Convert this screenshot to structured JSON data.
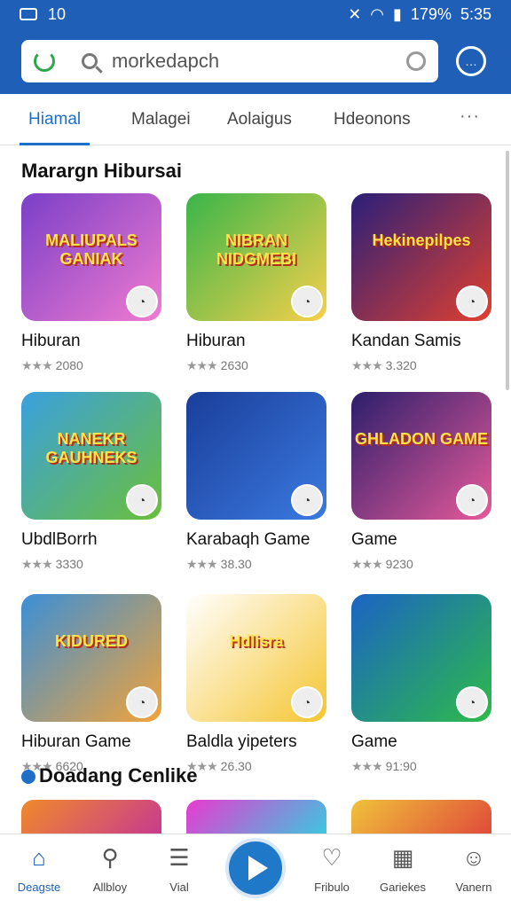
{
  "status": {
    "left_number": "10",
    "right_battery": "179%",
    "time": "5:35"
  },
  "search": {
    "value": "morkedapch"
  },
  "tabs": [
    {
      "label": "Hiamal",
      "active": true
    },
    {
      "label": "Malagei",
      "active": false
    },
    {
      "label": "Aolaigus",
      "active": false
    },
    {
      "label": "Hdeonons",
      "active": false
    }
  ],
  "tab_more": "···",
  "section1": {
    "title": "Marargn Hibursai"
  },
  "section2": {
    "title": "Doadang Cenlike"
  },
  "cards": [
    {
      "name": "Hiburan",
      "stars": "★★★",
      "rating": "2080",
      "art_text": "MALIUPALS GANIAK",
      "colors": [
        "#7a3fc8",
        "#f07bd0"
      ]
    },
    {
      "name": "Hiburan",
      "stars": "★★★",
      "rating": "2630",
      "art_text": "NIBRAN NIDGMEBI",
      "colors": [
        "#39b54a",
        "#f7d04b"
      ]
    },
    {
      "name": "Kandan Samis",
      "stars": "★★★",
      "rating": "3.320",
      "art_text": "Hekinepilpes",
      "colors": [
        "#2a1f7a",
        "#e0402f"
      ]
    },
    {
      "name": "UbdlBorrh",
      "stars": "★★★",
      "rating": "3330",
      "art_text": "NANEKR GAUHNEKS",
      "colors": [
        "#3aa0e0",
        "#6bbf3b"
      ]
    },
    {
      "name": "Karabaqh Game",
      "stars": "★★★",
      "rating": "38.30",
      "art_text": "",
      "colors": [
        "#1a3e9a",
        "#3b7ae0"
      ]
    },
    {
      "name": "Game",
      "stars": "★★★",
      "rating": "9230",
      "art_text": "GHLADON GAME",
      "colors": [
        "#2b1e6b",
        "#e85a9a"
      ]
    },
    {
      "name": "Hiburan Game",
      "stars": "★★★",
      "rating": "6620",
      "art_text": "KIDURED",
      "colors": [
        "#3a8fd8",
        "#f2a33a"
      ]
    },
    {
      "name": "Baldla yipeters",
      "stars": "★★★",
      "rating": "26.30",
      "art_text": "Hdlisra",
      "colors": [
        "#ffffff",
        "#f5c531"
      ]
    },
    {
      "name": "Game",
      "stars": "★★★",
      "rating": "91:90",
      "art_text": "",
      "colors": [
        "#1b63c4",
        "#2dbb4a"
      ]
    }
  ],
  "bottom_nav": [
    {
      "label": "Deagste",
      "icon": "home-icon",
      "active": true
    },
    {
      "label": "Allbloy",
      "icon": "search-icon",
      "active": false
    },
    {
      "label": "Vial",
      "icon": "list-icon",
      "active": false
    },
    {
      "label": "Fribulo",
      "icon": "gamepad-icon",
      "active": false
    },
    {
      "label": "Gariekes",
      "icon": "games-icon",
      "active": false
    },
    {
      "label": "Vanern",
      "icon": "person-icon",
      "active": false
    }
  ],
  "accent_color": "#1f5fb8"
}
